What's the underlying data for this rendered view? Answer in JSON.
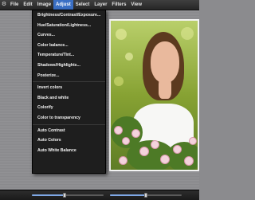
{
  "menubar": {
    "items": [
      "File",
      "Edit",
      "Image",
      "Adjust",
      "Select",
      "Layer",
      "Filters",
      "View"
    ],
    "active": "Adjust"
  },
  "adjust_menu": {
    "group1": [
      "Brightness/Contrast/Exposure...",
      "Hue/Saturation/Lightness...",
      "Curves...",
      "Color balance...",
      "Temperature/Tint...",
      "Shadows/Highlights...",
      "Posterize..."
    ],
    "group2": [
      "Invert colors",
      "Black and white",
      "Colorify",
      "Color to transparency"
    ],
    "group3": [
      "Auto Contrast",
      "Auto Colors",
      "Auto White Balance"
    ]
  },
  "statusbar": {
    "slider_left_value": 0.45,
    "slider_right_value": 0.5
  },
  "icons": {
    "menubar_left": "gear-icon"
  }
}
